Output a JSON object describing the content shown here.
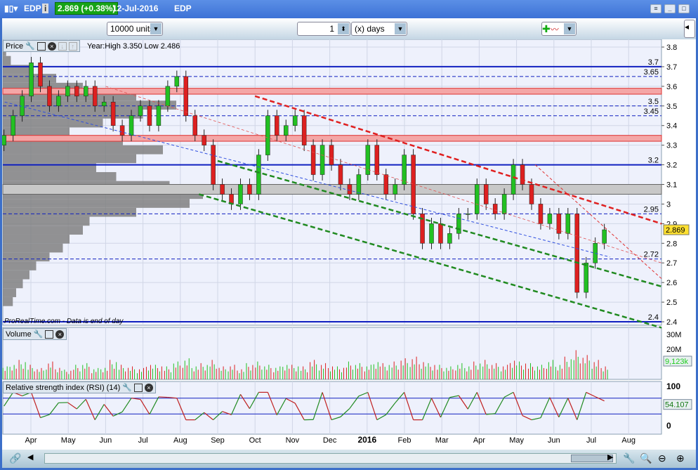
{
  "title": {
    "symbol": "EDP",
    "price_change": "2.869 (+0.38%)",
    "date": "12-Jul-2016",
    "name": "EDP"
  },
  "toolbar": {
    "units": "10000 units",
    "period_value": "1",
    "period_unit": "(x) days"
  },
  "price_panel": {
    "label": "Price",
    "info": "Year:High 3.350 Low 2.486",
    "current_price": "2.869",
    "watermark": "ProRealTime.com - Data is end of day"
  },
  "volume_panel": {
    "label": "Volume",
    "current": "9,123k"
  },
  "rsi_panel": {
    "label": "Relative strength index (RSI) (14)",
    "current": "54.107"
  },
  "chart_data": {
    "type": "candlestick",
    "price_axis": {
      "range": [
        2.38,
        3.82
      ],
      "ticks": [
        "3.8",
        "3.7",
        "3.6",
        "3.5",
        "3.4",
        "3.3",
        "3.2",
        "3.1",
        "3",
        "2.9",
        "2.8",
        "2.7",
        "2.6",
        "2.5",
        "2.4"
      ]
    },
    "volume_axis": {
      "ticks": [
        "30M",
        "20M"
      ]
    },
    "rsi_axis": {
      "ticks": [
        "100",
        "0"
      ],
      "levels": [
        70,
        30
      ]
    },
    "months": [
      "Apr",
      "May",
      "Jun",
      "Jul",
      "Aug",
      "Sep",
      "Oct",
      "Nov",
      "Dec",
      "2016",
      "Feb",
      "Mar",
      "Apr",
      "May",
      "Jun",
      "Jul",
      "Aug"
    ],
    "weekly_close": [
      3.35,
      3.45,
      3.55,
      3.72,
      3.6,
      3.5,
      3.55,
      3.6,
      3.55,
      3.6,
      3.5,
      3.52,
      3.4,
      3.35,
      3.45,
      3.5,
      3.4,
      3.5,
      3.6,
      3.65,
      3.45,
      3.35,
      3.3,
      3.1,
      3.05,
      3.0,
      3.1,
      3.05,
      3.25,
      3.45,
      3.35,
      3.4,
      3.45,
      3.3,
      3.15,
      3.3,
      3.2,
      3.1,
      3.05,
      3.15,
      3.3,
      3.15,
      3.05,
      3.1,
      3.25,
      2.95,
      2.8,
      2.9,
      2.8,
      2.85,
      2.95,
      2.95,
      3.1,
      3.0,
      2.95,
      3.05,
      3.2,
      3.1,
      3.0,
      2.9,
      2.95,
      2.85,
      2.95,
      2.55,
      2.7,
      2.8,
      2.869
    ],
    "weekly_volume_m": [
      8,
      10,
      12,
      9,
      7,
      11,
      8,
      6,
      9,
      10,
      7,
      8,
      12,
      9,
      8,
      7,
      10,
      9,
      8,
      11,
      13,
      9,
      10,
      12,
      8,
      9,
      7,
      10,
      11,
      9,
      8,
      10,
      9,
      8,
      12,
      10,
      9,
      8,
      11,
      10,
      9,
      12,
      10,
      11,
      13,
      14,
      12,
      10,
      9,
      8,
      10,
      9,
      11,
      12,
      10,
      9,
      13,
      11,
      10,
      9,
      12,
      10,
      14,
      18,
      15,
      12,
      9
    ],
    "volume_profile": [
      5,
      12,
      40,
      80,
      120,
      200,
      260,
      210,
      150,
      100,
      180,
      240,
      200,
      140,
      170,
      250,
      300,
      280,
      200,
      130,
      120,
      100,
      90,
      70,
      50,
      40,
      30,
      20,
      15
    ],
    "horizontal_levels": [
      {
        "value": 3.7,
        "label": "3.7",
        "style": "solid"
      },
      {
        "value": 3.65,
        "label": "3.65",
        "style": "dash"
      },
      {
        "value": 3.5,
        "label": "3.5",
        "style": "dash"
      },
      {
        "value": 3.45,
        "label": "3.45",
        "style": "dash"
      },
      {
        "value": 3.2,
        "label": "3.2",
        "style": "solid"
      },
      {
        "value": 2.95,
        "label": "2.95",
        "style": "dash"
      },
      {
        "value": 2.72,
        "label": "2.72",
        "style": "dash"
      },
      {
        "value": 2.4,
        "label": "2.4",
        "style": "solid"
      }
    ],
    "zones": [
      {
        "from": 3.56,
        "to": 3.59,
        "color": "#f4a6a6"
      },
      {
        "from": 3.32,
        "to": 3.35,
        "color": "#f4a6a6"
      },
      {
        "from": 3.05,
        "to": 3.1,
        "color": "#c8c8c8"
      }
    ],
    "trendlines": [
      {
        "from": [
          6,
          3.55
        ],
        "to": [
          17.8,
          2.9
        ],
        "color": "#e02020",
        "w": 2.5
      },
      {
        "from": [
          5,
          3.22
        ],
        "to": [
          17.8,
          2.58
        ],
        "color": "#208a20",
        "w": 2.5
      },
      {
        "from": [
          4.5,
          3.05
        ],
        "to": [
          17.8,
          2.37
        ],
        "color": "#208a20",
        "w": 2.5
      },
      {
        "from": [
          -0.7,
          3.52
        ],
        "to": [
          15.5,
          2.73
        ],
        "color": "#3050e0",
        "w": 1
      },
      {
        "from": [
          13.5,
          3.2
        ],
        "to": [
          17.8,
          2.62
        ],
        "color": "#e03030",
        "w": 1
      },
      {
        "from": [
          2,
          3.6
        ],
        "to": [
          17.8,
          2.7
        ],
        "color": "#e05050",
        "w": 0.8
      }
    ]
  },
  "colors": {
    "up": "#22c022",
    "down": "#dd2020",
    "accent": "#3c6fc9"
  }
}
